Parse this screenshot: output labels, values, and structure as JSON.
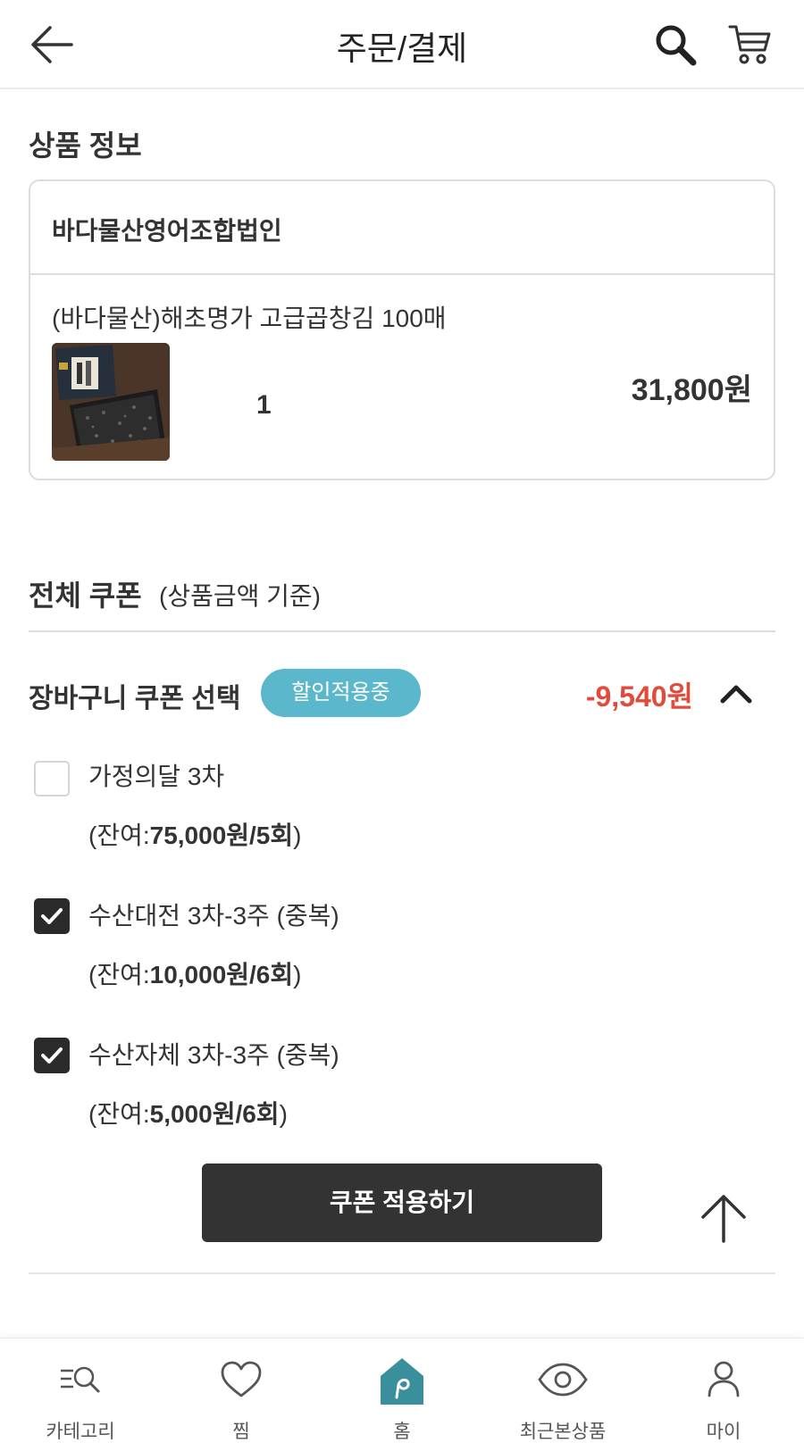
{
  "header": {
    "title": "주문/결제",
    "back_icon": "arrow-left-icon",
    "search_icon": "search-icon",
    "cart_icon": "cart-icon"
  },
  "product_section": {
    "title": "상품 정보",
    "seller": "바다물산영어조합법인",
    "product_name": "(바다물산)해초명가 고급곱창김 100매",
    "quantity": "1",
    "price": "31,800원"
  },
  "coupon_section": {
    "title": "전체 쿠폰",
    "subtitle": "(상품금액 기준)",
    "basket_label": "장바구니 쿠폰 선택",
    "badge": "할인적용중",
    "discount": "-9,540원",
    "coupons": [
      {
        "name": "가정의달 3차",
        "remain_prefix": "(잔여:",
        "remain_value": "75,000원/5회",
        "remain_suffix": ")",
        "checked": false
      },
      {
        "name": "수산대전 3차-3주 (중복)",
        "remain_prefix": "(잔여:",
        "remain_value": "10,000원/6회",
        "remain_suffix": ")",
        "checked": true
      },
      {
        "name": "수산자체 3차-3주 (중복)",
        "remain_prefix": "(잔여:",
        "remain_value": "5,000원/6회",
        "remain_suffix": ")",
        "checked": true
      }
    ],
    "apply_button": "쿠폰 적용하기"
  },
  "tabbar": {
    "tabs": [
      {
        "label": "카테고리",
        "icon": "category-search-icon"
      },
      {
        "label": "찜",
        "icon": "heart-icon"
      },
      {
        "label": "홈",
        "icon": "home-icon"
      },
      {
        "label": "최근본상품",
        "icon": "eye-icon"
      },
      {
        "label": "마이",
        "icon": "person-icon"
      }
    ]
  },
  "colors": {
    "accent_badge": "#5bb8cc",
    "discount_red": "#e04b3a",
    "home_teal": "#3a8f9c",
    "button_dark": "#333333"
  }
}
